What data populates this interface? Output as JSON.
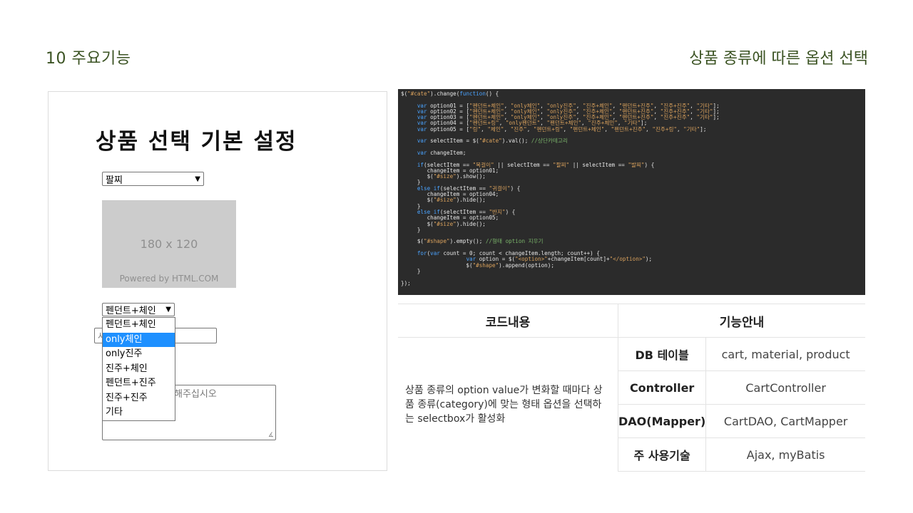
{
  "slide": {
    "title": "10 주요기능",
    "subtitle": "상품 종류에 따른 옵션 선택"
  },
  "screenshot": {
    "heading": "상품 선택 기본 설정",
    "bracelet_select": "팔찌",
    "placeholder_image": {
      "size_text": "180 x 120",
      "powered_text": "Powered by HTML.COM"
    },
    "shape_select": "펜던트+체인",
    "dropdown_options": [
      "펜던트+체인",
      "only체인",
      "only진주",
      "진주+체인",
      "펜던트+진주",
      "진주+진주",
      "기타"
    ],
    "selected_option": "only체인",
    "input_placeholder": "사",
    "textarea_placeholder": "해주십시오"
  },
  "code": {
    "lines": [
      "$(\"#cate\").change(function() {",
      "",
      "     var option01 = [\"펜던트+체인\", \"only체인\", \"only진주\", \"진주+체인\", \"펜던트+진주\", \"진주+진주\", \"기타\"];",
      "     var option02 = [\"펜던트+체인\", \"only체인\", \"only진주\", \"진주+체인\", \"펜던트+진주\", \"진주+진주\", \"기타\"];",
      "     var option03 = [\"펜던트+체인\", \"only체인\", \"only진주\", \"진주+체인\", \"펜던트+진주\", \"진주+진주\", \"기타\"];",
      "     var option04 = [\"펜던트+링\", \"only펜던트\", \"펜던트+체인\", \"진주+체인\", \"기타\"];",
      "     var option05 = [\"링\", \"체인\", \"진주\", \"펜던트+링\", \"펜던트+체인\", \"펜던트+진주\", \"진주+링\", \"기타\"];",
      "",
      "     var selectItem = $(\"#cate\").val(); //상단카테고리",
      "",
      "     var changeItem;",
      "",
      "     if(selectItem == \"목걸이\" || selectItem == \"팔찌\" || selectItem == \"발찌\") {",
      "        changeItem = option01;",
      "        $(\"#size\").show();",
      "     }",
      "     else if(selectItem == \"귀걸이\") {",
      "        changeItem = option04;",
      "        $(\"#size\").hide();",
      "     }",
      "     else if(selectItem == \"반지\") {",
      "        changeItem = option05;",
      "        $(\"#size\").hide();",
      "     }",
      "",
      "     $(\"#shape\").empty(); //형태 option 지우기",
      "",
      "     for(var count = 0; count < changeItem.length; count++) {",
      "                    var option = $(\"<option>\"+changeItem[count]+\"</option>\");",
      "                    $(\"#shape\").append(option);",
      "     }",
      "",
      "});"
    ]
  },
  "table": {
    "header_left": "코드내용",
    "header_right": "기능안내",
    "description": "상품 종류의 option value가 변화할 때마다 상품 종류(category)에 맞는 형태 옵션을 선택하는 selectbox가 활성화",
    "rows": [
      {
        "key": "DB 테이블",
        "value": "cart, material, product"
      },
      {
        "key": "Controller",
        "value": "CartController"
      },
      {
        "key": "DAO(Mapper)",
        "value": "CartDAO, CartMapper"
      },
      {
        "key": "주 사용기술",
        "value": "Ajax, myBatis"
      }
    ]
  },
  "colors": {
    "title_green": "#3b5323",
    "code_bg": "#2b2b2b",
    "dropdown_highlight": "#1e90ff",
    "placeholder_gray": "#cccccc"
  }
}
